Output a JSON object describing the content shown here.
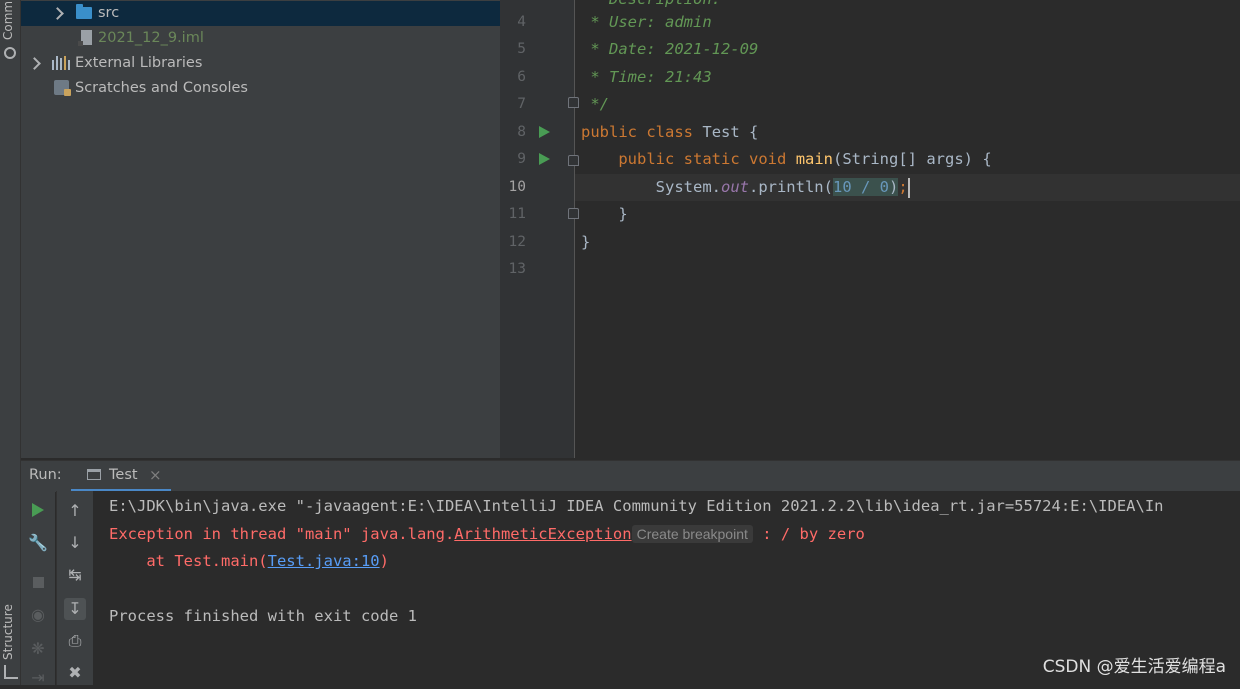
{
  "left_stripe": {
    "commit_label": "Commit",
    "structure_label": "Structure"
  },
  "project_tree": {
    "items": [
      {
        "label": "src",
        "icon": "folder-icon"
      },
      {
        "label": "2021_12_9.iml",
        "icon": "iml-file-icon"
      },
      {
        "label": "External Libraries",
        "icon": "libraries-icon"
      },
      {
        "label": "Scratches and Consoles",
        "icon": "scratches-icon"
      }
    ]
  },
  "editor": {
    "line_numbers": [
      "4",
      "5",
      "6",
      "7",
      "8",
      "9",
      "10",
      "11",
      "12",
      "13"
    ],
    "current_line": "10",
    "comment": {
      "partial": " * Description:",
      "user": " * User: admin",
      "date": " * Date: 2021-12-09",
      "time": " * Time: 21:43",
      "end": " */"
    },
    "class_line": {
      "kw1": "public",
      "kw2": "class",
      "name": "Test",
      "brace": "{"
    },
    "method_line": {
      "kw1": "public",
      "kw2": "static",
      "kw3": "void",
      "name": "main",
      "params": "(String[] args) {"
    },
    "print_line": {
      "prefix": "System.",
      "field": "out",
      "call": ".println(",
      "expr": "10 / 0",
      "close": ")",
      "semi": ";"
    },
    "close_method": "}",
    "close_class": "}"
  },
  "run_panel": {
    "label": "Run:",
    "tab_label": "Test",
    "tab_close": "×",
    "console": {
      "cmd": "E:\\JDK\\bin\\java.exe \"-javaagent:E:\\IDEA\\IntelliJ IDEA Community Edition 2021.2.2\\lib\\idea_rt.jar=55724:E:\\IDEA\\In",
      "err_prefix": "Exception in thread \"main\" java.lang.",
      "exception": "ArithmeticException",
      "breakpoint": "Create breakpoint",
      "err_suffix": " : / by zero",
      "at_prefix": "    at Test.main(",
      "at_link": "Test.java:10",
      "at_suffix": ")",
      "finished": "Process finished with exit code 1"
    }
  },
  "watermark": "CSDN @爱生活爱编程a"
}
